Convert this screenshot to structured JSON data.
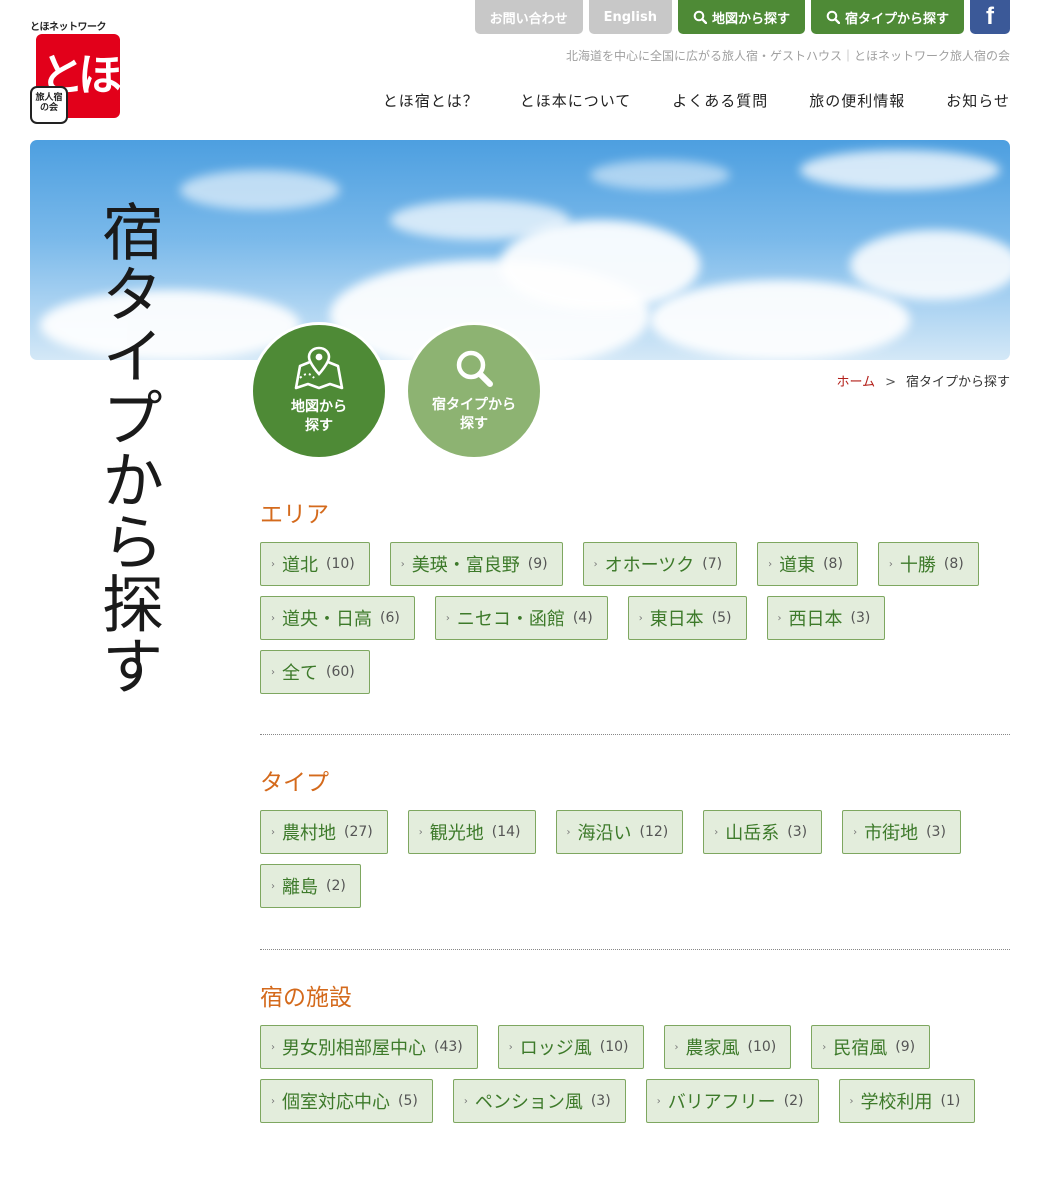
{
  "logo": {
    "top_text": "とほネットワーク",
    "main_text": "とほ",
    "seal_text": "旅人宿の会"
  },
  "top_buttons": {
    "contact": "お問い合わせ",
    "english": "English",
    "map_search": "地図から探す",
    "type_search": "宿タイプから探す",
    "facebook": "f"
  },
  "tagline": "北海道を中心に全国に広がる旅人宿・ゲストハウス｜とほネットワーク旅人宿の会",
  "nav": [
    "とほ宿とは？",
    "とほ本について",
    "よくある質問",
    "旅の便利情報",
    "お知らせ"
  ],
  "page_title": "宿タイプから探す",
  "circles": {
    "map": {
      "line1": "地図から",
      "line2": "探す"
    },
    "type": {
      "line1": "宿タイプから",
      "line2": "探す"
    }
  },
  "breadcrumb": {
    "home": "ホーム",
    "separator": ">",
    "current": "宿タイプから探す"
  },
  "sections": [
    {
      "title": "エリア",
      "tags": [
        {
          "label": "道北",
          "count": "(10)"
        },
        {
          "label": "美瑛・富良野",
          "count": "(9)"
        },
        {
          "label": "オホーツク",
          "count": "(7)"
        },
        {
          "label": "道東",
          "count": "(8)"
        },
        {
          "label": "十勝",
          "count": "(8)"
        },
        {
          "label": "道央・日高",
          "count": "(6)"
        },
        {
          "label": "ニセコ・函館",
          "count": "(4)"
        },
        {
          "label": "東日本",
          "count": "(5)"
        },
        {
          "label": "西日本",
          "count": "(3)"
        },
        {
          "label": "全て",
          "count": "(60)"
        }
      ]
    },
    {
      "title": "タイプ",
      "tags": [
        {
          "label": "農村地",
          "count": "(27)"
        },
        {
          "label": "観光地",
          "count": "(14)"
        },
        {
          "label": "海沿い",
          "count": "(12)"
        },
        {
          "label": "山岳系",
          "count": "(3)"
        },
        {
          "label": "市街地",
          "count": "(3)"
        },
        {
          "label": "離島",
          "count": "(2)"
        }
      ]
    },
    {
      "title": "宿の施設",
      "tags": [
        {
          "label": "男女別相部屋中心",
          "count": "(43)"
        },
        {
          "label": "ロッジ風",
          "count": "(10)"
        },
        {
          "label": "農家風",
          "count": "(10)"
        },
        {
          "label": "民宿風",
          "count": "(9)"
        },
        {
          "label": "個室対応中心",
          "count": "(5)"
        },
        {
          "label": "ペンション風",
          "count": "(3)"
        },
        {
          "label": "バリアフリー",
          "count": "(2)"
        },
        {
          "label": "学校利用",
          "count": "(1)"
        }
      ]
    }
  ],
  "colors": {
    "accent_green": "#4e8a36",
    "light_green": "#8db372",
    "tag_bg": "#e3eddc",
    "section_title": "#d46a1c",
    "logo_red": "#e2001a",
    "facebook_blue": "#3b5998"
  }
}
